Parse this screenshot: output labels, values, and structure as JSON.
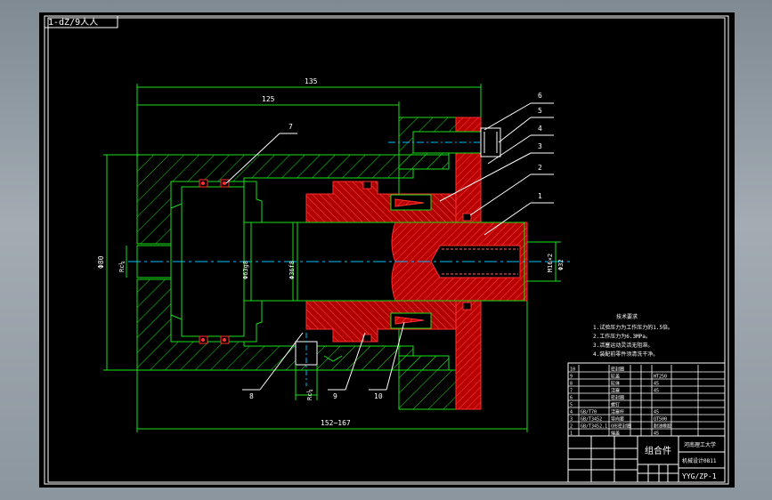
{
  "drawing_code": "1-dZ/9人人",
  "dimensions": {
    "overall_length": "135",
    "inner_length": "125",
    "bottom_length": "152~167",
    "left_dia": "Φ80",
    "port_left": "Rc¼",
    "piston_dia": "Φ63g8",
    "rod_dia": "Φ36f8",
    "bore_dia": "Φ32",
    "thread": "M16×2",
    "port_bottom": "Rc¼"
  },
  "balloons": [
    "1",
    "2",
    "3",
    "4",
    "5",
    "6",
    "7",
    "8",
    "9",
    "10"
  ],
  "tech_title": "技术要求",
  "tech_notes": [
    "1.试验压力为工作压力的1.5倍。",
    "2.工作压力为6.3MPa。",
    "3.活塞运动灵活无阻滞。",
    "4.装配前零件须清洗干净。"
  ],
  "title_block": {
    "part_name": "组合件",
    "school": "河南理工大学",
    "class_name": "机械设计0811",
    "drawing_no": "YYG/ZP-1",
    "bom_rows": [
      [
        "10",
        "",
        "密封圈",
        "",
        "",
        "",
        "",
        ""
      ],
      [
        "9",
        "",
        "缸盖",
        "",
        "",
        "HT250",
        "",
        ""
      ],
      [
        "8",
        "",
        "缸体",
        "",
        "",
        "45",
        "",
        ""
      ],
      [
        "7",
        "",
        "活塞",
        "",
        "",
        "45",
        "",
        ""
      ],
      [
        "6",
        "",
        "密封圈",
        "",
        "",
        "",
        "",
        ""
      ],
      [
        "5",
        "",
        "螺钉",
        "",
        "",
        "",
        "",
        ""
      ],
      [
        "4",
        "GB/T70",
        "活塞杆",
        "",
        "",
        "45",
        "",
        ""
      ],
      [
        "3",
        "GB/T3452",
        "导向套",
        "",
        "",
        "QT500",
        "",
        ""
      ],
      [
        "2",
        "GB/T3452.1",
        "O形密封圈",
        "",
        "",
        "耐油橡胶",
        "",
        ""
      ],
      [
        "1",
        "",
        "端盖",
        "",
        "",
        "45",
        "",
        ""
      ]
    ]
  }
}
